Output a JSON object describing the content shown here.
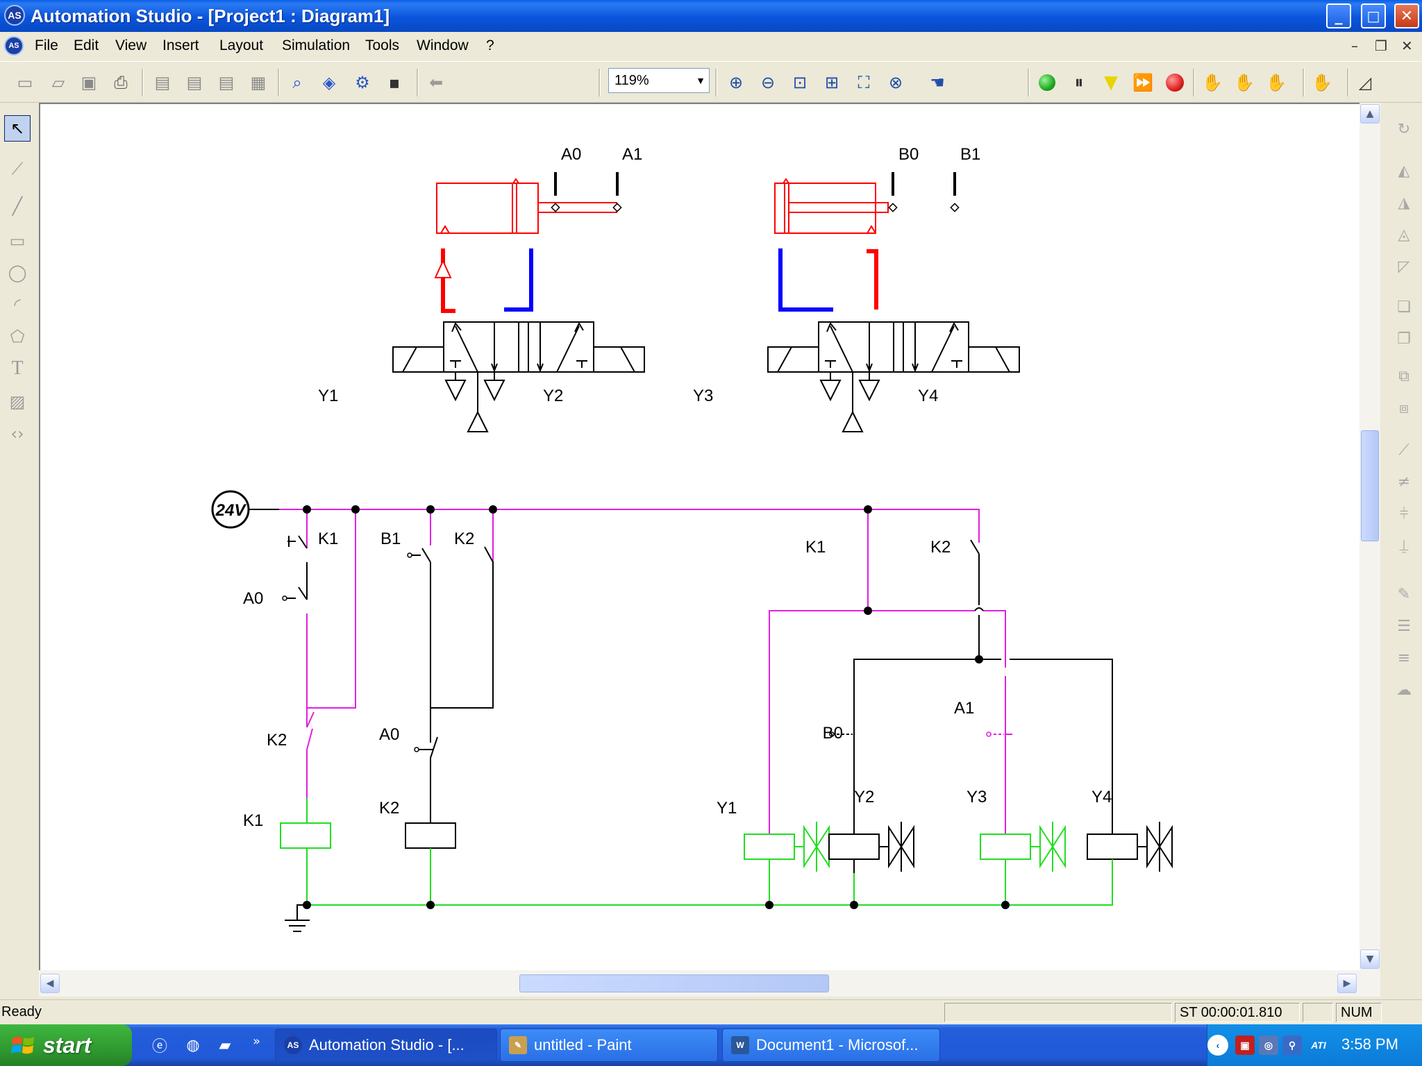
{
  "window": {
    "app_icon": "AS",
    "title": "Automation Studio - [Project1 : Diagram1]",
    "minimize_icon": "_",
    "maximize_icon": "□",
    "close_icon": "✕"
  },
  "menu": {
    "items": [
      {
        "label": "File"
      },
      {
        "label": "Edit"
      },
      {
        "label": "View"
      },
      {
        "label": "Insert"
      },
      {
        "label": "Layout"
      },
      {
        "label": "Simulation"
      },
      {
        "label": "Tools"
      },
      {
        "label": "Window"
      },
      {
        "label": "?"
      }
    ],
    "mdi_minimize": "–",
    "mdi_restore": "❐",
    "mdi_close": "✕"
  },
  "toolbar": {
    "zoom_value": "119%",
    "zoom_arrow": "▼",
    "colors": {
      "run": "#1ea91e",
      "pause": "#333333",
      "step": "#e8d400",
      "stop": "#e02020"
    }
  },
  "diagram": {
    "pneumatic": {
      "sensor_a0": "A0",
      "sensor_a1": "A1",
      "sensor_b0": "B0",
      "sensor_b1": "B1",
      "solenoid_y1": "Y1",
      "solenoid_y2": "Y2",
      "solenoid_y3": "Y3",
      "solenoid_y4": "Y4"
    },
    "electrical": {
      "supply": "24V",
      "contact_k1_hold": "K1",
      "contact_a0_start": "A0",
      "contact_k2_nc": "K2",
      "relay_k1": "K1",
      "contact_b1": "B1",
      "contact_k2_hold": "K2",
      "contact_a0_nc": "A0",
      "relay_k2": "K2",
      "contact_k1_out": "K1",
      "contact_k2_out": "K2",
      "contact_b0": "B0",
      "contact_a1": "A1",
      "coil_y1": "Y1",
      "coil_y2": "Y2",
      "coil_y3": "Y3",
      "coil_y4": "Y4"
    },
    "colors": {
      "pressure": "#ff0000",
      "exhaust": "#0000ff",
      "energized_wire": "#e020e0",
      "ground_wire": "#22dd22",
      "idle": "#000000"
    }
  },
  "status": {
    "ready": "Ready",
    "sim_time": "ST 00:00:01.810",
    "num": "NUM"
  },
  "taskbar": {
    "start_label": "start",
    "tasks": [
      {
        "label": "Automation Studio - [..."
      },
      {
        "label": "untitled - Paint"
      },
      {
        "label": "Document1 - Microsof..."
      }
    ],
    "tray_ati": "ATI",
    "clock": "3:58 PM"
  }
}
